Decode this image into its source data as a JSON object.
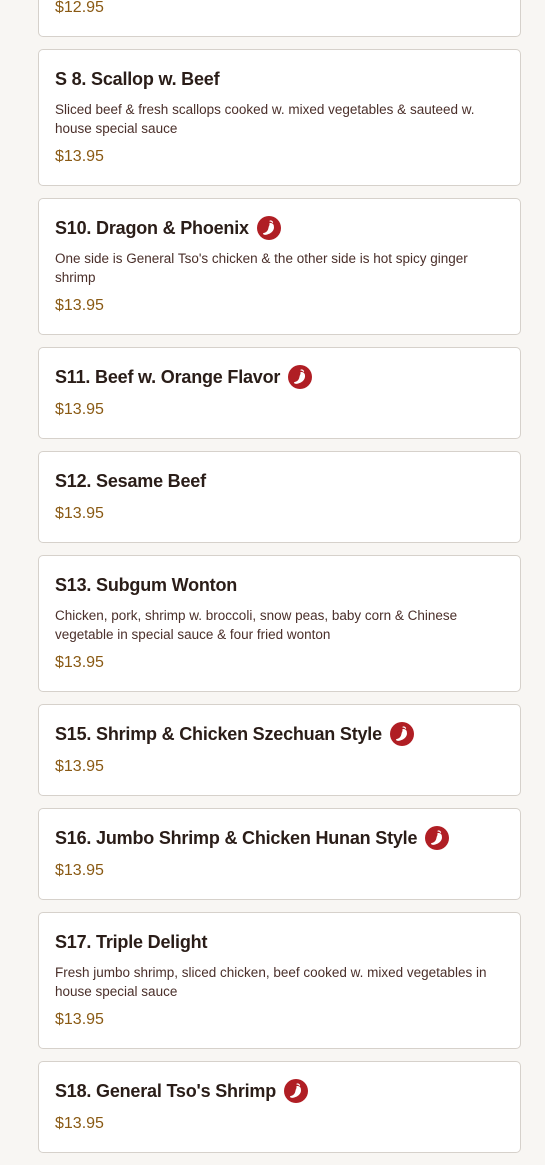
{
  "colors": {
    "background": "#f8f6f3",
    "card": "#ffffff",
    "card_border": "#d6d1cb",
    "title": "#2a1d18",
    "description": "#4a2f2a",
    "price": "#8a5a14",
    "spicy_badge": "#b01e24"
  },
  "items": [
    {
      "title": "",
      "description": "",
      "price": "$12.95",
      "spicy": false
    },
    {
      "title": "S 8. Scallop w. Beef",
      "description": "Sliced beef & fresh scallops cooked w. mixed vegetables & sauteed w. house special sauce",
      "price": "$13.95",
      "spicy": false
    },
    {
      "title": "S10. Dragon & Phoenix",
      "description": "One side is General Tso's chicken & the other side is hot spicy ginger shrimp",
      "price": "$13.95",
      "spicy": true,
      "icon": "chili-pepper-icon"
    },
    {
      "title": "S11. Beef w. Orange Flavor",
      "description": "",
      "price": "$13.95",
      "spicy": true,
      "icon": "chili-pepper-icon"
    },
    {
      "title": "S12. Sesame Beef",
      "description": "",
      "price": "$13.95",
      "spicy": false
    },
    {
      "title": "S13. Subgum Wonton",
      "description": "Chicken, pork, shrimp w. broccoli, snow peas, baby corn & Chinese vegetable in special sauce & four fried wonton",
      "price": "$13.95",
      "spicy": false
    },
    {
      "title": "S15. Shrimp & Chicken Szechuan Style",
      "description": "",
      "price": "$13.95",
      "spicy": true,
      "icon": "chili-pepper-icon"
    },
    {
      "title": "S16. Jumbo Shrimp & Chicken Hunan Style",
      "description": "",
      "price": "$13.95",
      "spicy": true,
      "icon": "chili-pepper-icon"
    },
    {
      "title": "S17. Triple Delight",
      "description": "Fresh jumbo shrimp, sliced chicken, beef cooked w. mixed vegetables in house special sauce",
      "price": "$13.95",
      "spicy": false
    },
    {
      "title": "S18. General Tso's Shrimp",
      "description": "",
      "price": "$13.95",
      "spicy": true,
      "icon": "chili-pepper-icon"
    }
  ]
}
